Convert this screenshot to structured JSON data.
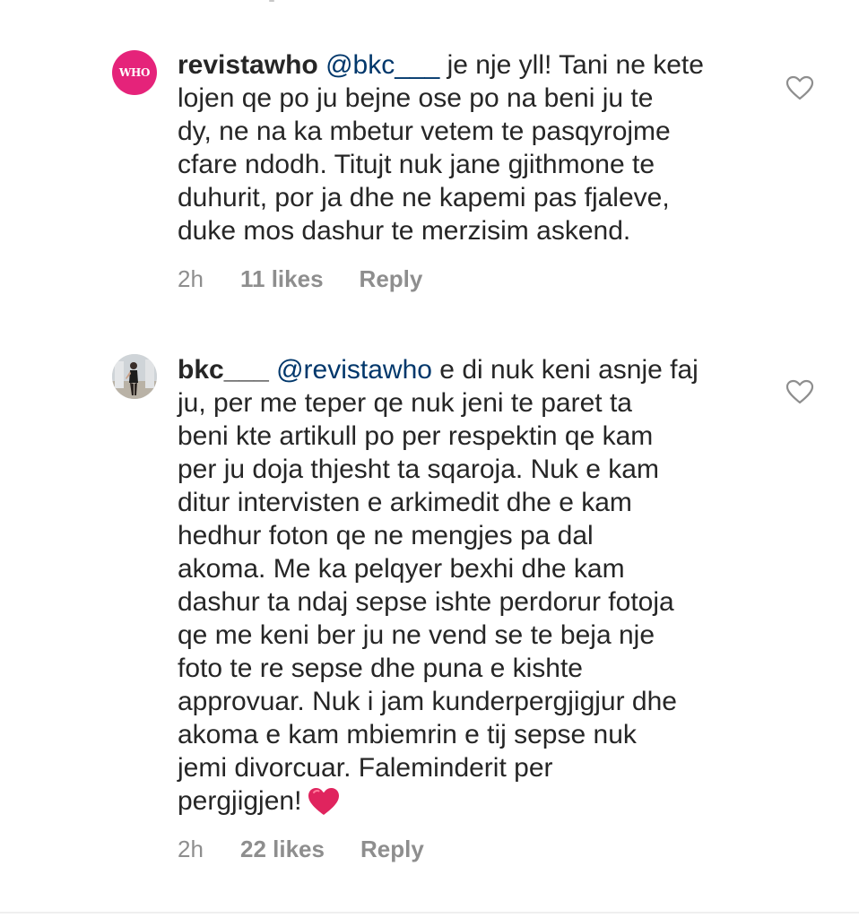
{
  "comments": [
    {
      "username": "revistawho",
      "avatar_text": "WHO",
      "mention": "@bkc___",
      "text_lines": [
        "je nje yll! Tani ne kete",
        "lojen qe po ju bejne ose po na beni ju te",
        "dy, ne na ka mbetur vetem te pasqyrojme",
        "cfare ndodh. Titujt nuk jane gjithmone te",
        "duhurit, por ja dhe ne kapemi pas fjaleve,",
        "duke mos dashur te merzisim askend."
      ],
      "time": "2h",
      "likes": "11 likes",
      "reply": "Reply"
    },
    {
      "username": "bkc___",
      "mention": "@revistawho",
      "text_lines": [
        "e di nuk keni asnje faj",
        "ju, per me teper qe nuk jeni te paret ta",
        "beni kte artikull po per respektin qe kam",
        "per ju doja thjesht ta sqaroja. Nuk e kam",
        "ditur intervisten e arkimedit dhe e kam",
        "hedhur foton qe ne mengjes pa dal",
        "akoma. Me ka pelqyer bexhi dhe kam",
        "dashur ta ndaj sepse ishte perdorur fotoja",
        "qe me keni ber ju ne vend se te beja nje",
        "foto te re sepse dhe puna e kishte",
        "approvuar. Nuk i jam kunderpergjigjur dhe",
        "akoma e kam mbiemrin e tij sepse nuk",
        "jemi divorcuar. Faleminderit per",
        "pergjigjen!"
      ],
      "emoji": "red-heart",
      "time": "2h",
      "likes": "22 likes",
      "reply": "Reply"
    }
  ],
  "colors": {
    "who_brand": "#e5237a",
    "mention": "#00376b",
    "meta_gray": "#8e8e8e",
    "heart_red": "#e0245e"
  },
  "icons": [
    "heart-outline-icon",
    "red-heart-emoji"
  ]
}
